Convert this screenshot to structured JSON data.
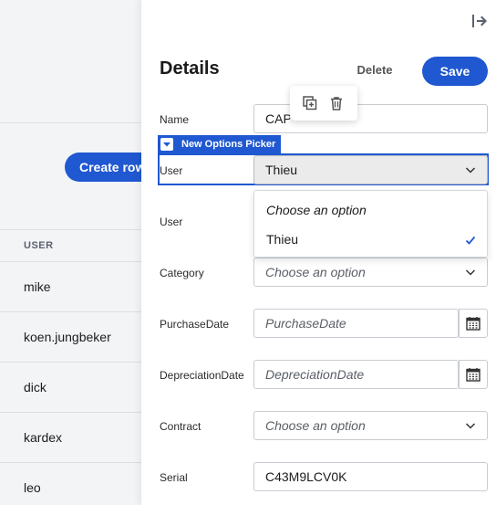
{
  "background": {
    "create_row_label": "Create row",
    "table_header": "USER",
    "users": [
      "mike",
      "koen.jungbeker",
      "dick",
      "kardex",
      "leo"
    ]
  },
  "panel": {
    "title": "Details",
    "delete_label": "Delete",
    "save_label": "Save",
    "component_tag": "New Options Picker",
    "fields": {
      "name": {
        "label": "Name",
        "value": "CAP-"
      },
      "user_picker": {
        "label": "User",
        "value": "Thieu"
      },
      "user2": {
        "label": "User"
      },
      "category": {
        "label": "Category",
        "placeholder": "Choose an option"
      },
      "purchase_date": {
        "label": "PurchaseDate",
        "placeholder": "PurchaseDate"
      },
      "depreciation_date": {
        "label": "DepreciationDate",
        "placeholder": "DepreciationDate"
      },
      "contract": {
        "label": "Contract",
        "placeholder": "Choose an option"
      },
      "serial": {
        "label": "Serial",
        "value": "C43M9LCV0K"
      }
    },
    "dropdown": {
      "options": [
        "Choose an option",
        "Thieu"
      ],
      "selected": "Thieu"
    }
  },
  "colors": {
    "accent": "#1f58d0"
  },
  "icons": [
    "exit-icon",
    "copy-add-icon",
    "trash-icon",
    "chevron-down-icon",
    "calendar-icon",
    "check-icon",
    "collapse-icon"
  ]
}
